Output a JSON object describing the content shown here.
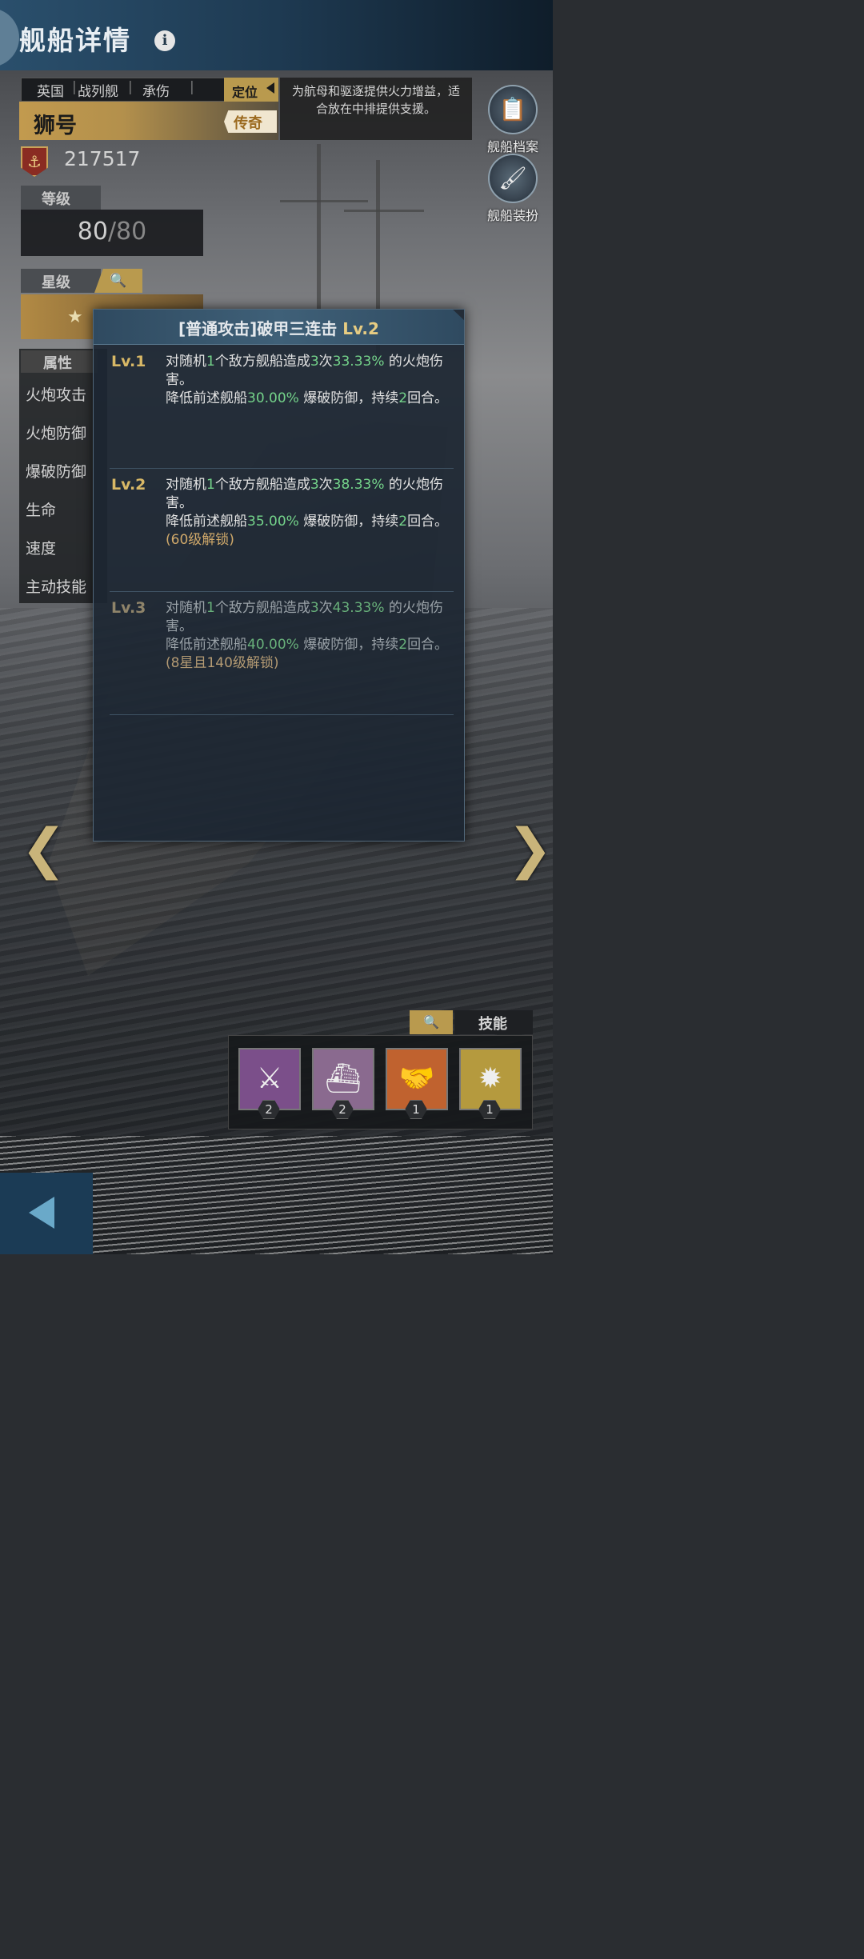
{
  "header": {
    "title": "舰船详情",
    "info_icon": "i"
  },
  "ship": {
    "nation": "英国",
    "type": "战列舰",
    "role": "承伤",
    "position_label": "定位",
    "name": "狮号",
    "rarity": "传奇",
    "description": "为航母和驱逐提供火力增益，适合放在中排提供支援。",
    "power": "217517"
  },
  "side_buttons": [
    {
      "label": "舰船档案",
      "icon": "clipboard-icon"
    },
    {
      "label": "舰船装扮",
      "icon": "paint-roller-icon"
    }
  ],
  "level": {
    "header": "等级",
    "current": "80",
    "max": "/80"
  },
  "star": {
    "header": "星级"
  },
  "attributes": {
    "header": "属性",
    "rows": [
      "火炮攻击",
      "火炮防御",
      "爆破防御",
      "生命",
      "速度",
      "主动技能"
    ]
  },
  "skill_popup": {
    "title_prefix": "[普通攻击]破甲三连击 ",
    "title_level": "Lv.2",
    "levels": [
      {
        "tag": "Lv.1",
        "p1": "对随机",
        "n1": "1",
        "p2": "个敌方舰船造成",
        "n2": "3",
        "p3": "次",
        "n3": "33.33%",
        "p4": " 的火炮伤害。",
        "p5": "降低前述舰船",
        "n4": "30.00%",
        "p6": " 爆破防御，持续",
        "n5": "2",
        "p7": "回合。",
        "unlock": ""
      },
      {
        "tag": "Lv.2",
        "p1": "对随机",
        "n1": "1",
        "p2": "个敌方舰船造成",
        "n2": "3",
        "p3": "次",
        "n3": "38.33%",
        "p4": " 的火炮伤害。",
        "p5": "降低前述舰船",
        "n4": "35.00%",
        "p6": " 爆破防御，持续",
        "n5": "2",
        "p7": "回合。",
        "unlock": "(60级解锁)"
      },
      {
        "tag": "Lv.3",
        "p1": "对随机",
        "n1": "1",
        "p2": "个敌方舰船造成",
        "n2": "3",
        "p3": "次",
        "n3": "43.33%",
        "p4": " 的火炮伤害。",
        "p5": "降低前述舰船",
        "n4": "40.00%",
        "p6": " 爆破防御，持续",
        "n5": "2",
        "p7": "回合。",
        "unlock": "(8星且140级解锁)"
      }
    ]
  },
  "nav": {
    "prev": "❮",
    "next": "❯"
  },
  "skills": {
    "tab_label": "技能",
    "items": [
      {
        "icon": "cannon-icon",
        "level": "2",
        "color": "#7b4f8a"
      },
      {
        "icon": "warship-icon",
        "level": "2",
        "color": "#8a6a8f"
      },
      {
        "icon": "handshake-icon",
        "level": "1",
        "color": "#c0622f"
      },
      {
        "icon": "burst-icon",
        "level": "1",
        "color": "#b59a3e"
      }
    ]
  }
}
